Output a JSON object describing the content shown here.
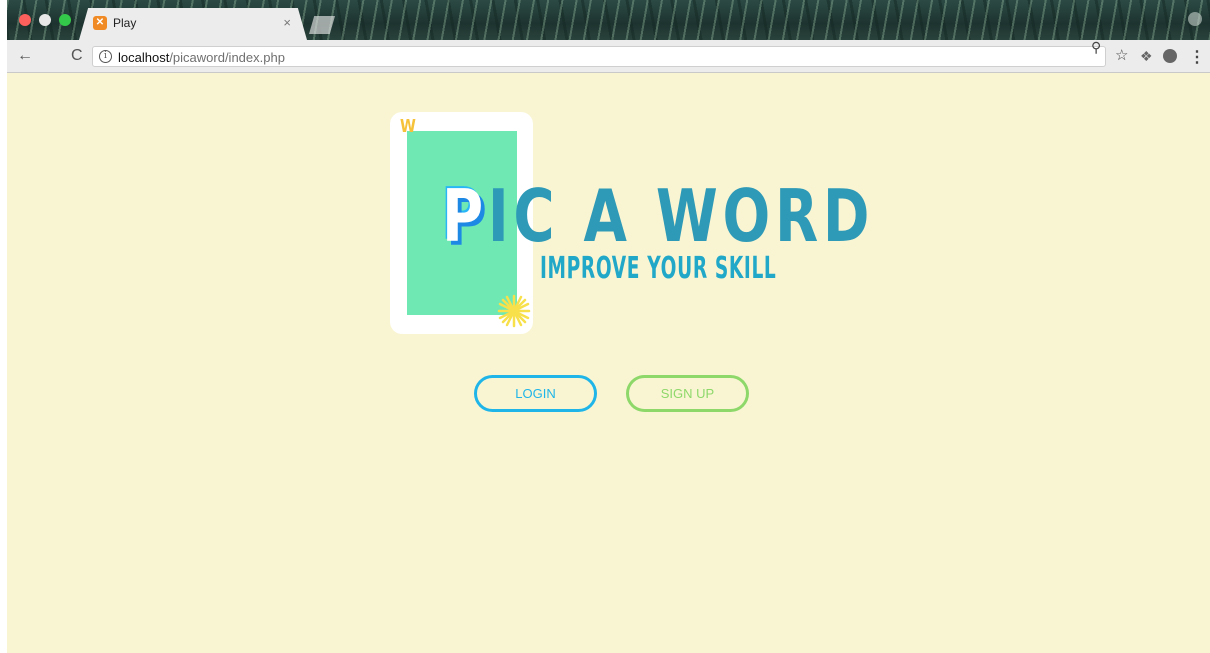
{
  "browser": {
    "tab": {
      "title": "Play",
      "favicon": "xampp-icon",
      "close": "×"
    },
    "address": {
      "host": "localhost",
      "path": "/picaword/index.php"
    },
    "icons": [
      "back-icon",
      "reload-icon",
      "info-icon",
      "key-icon",
      "star-icon",
      "dropbox-icon",
      "extension-icon",
      "menu-icon"
    ],
    "glyphs": {
      "back": "←",
      "reload": "C",
      "info": "i",
      "key": "⚲",
      "star": "☆",
      "dropbox": "❖",
      "menu": "⋮"
    }
  },
  "logo": {
    "card_letter": "W",
    "title_first": "P",
    "title_rest": "IC A WORD",
    "subtitle": "IMPROVE YOUR SKILL",
    "colors": {
      "card": "#6fe8b4",
      "title": "#2f9ab7",
      "subtitle": "#21a8c8",
      "accent": "#f5c23a"
    }
  },
  "actions": {
    "login_label": "LOGIN",
    "signup_label": "SIGN UP",
    "colors": {
      "login": "#1fb5e8",
      "signup": "#8ed86a"
    }
  },
  "page": {
    "background": "#f9f5d3"
  }
}
